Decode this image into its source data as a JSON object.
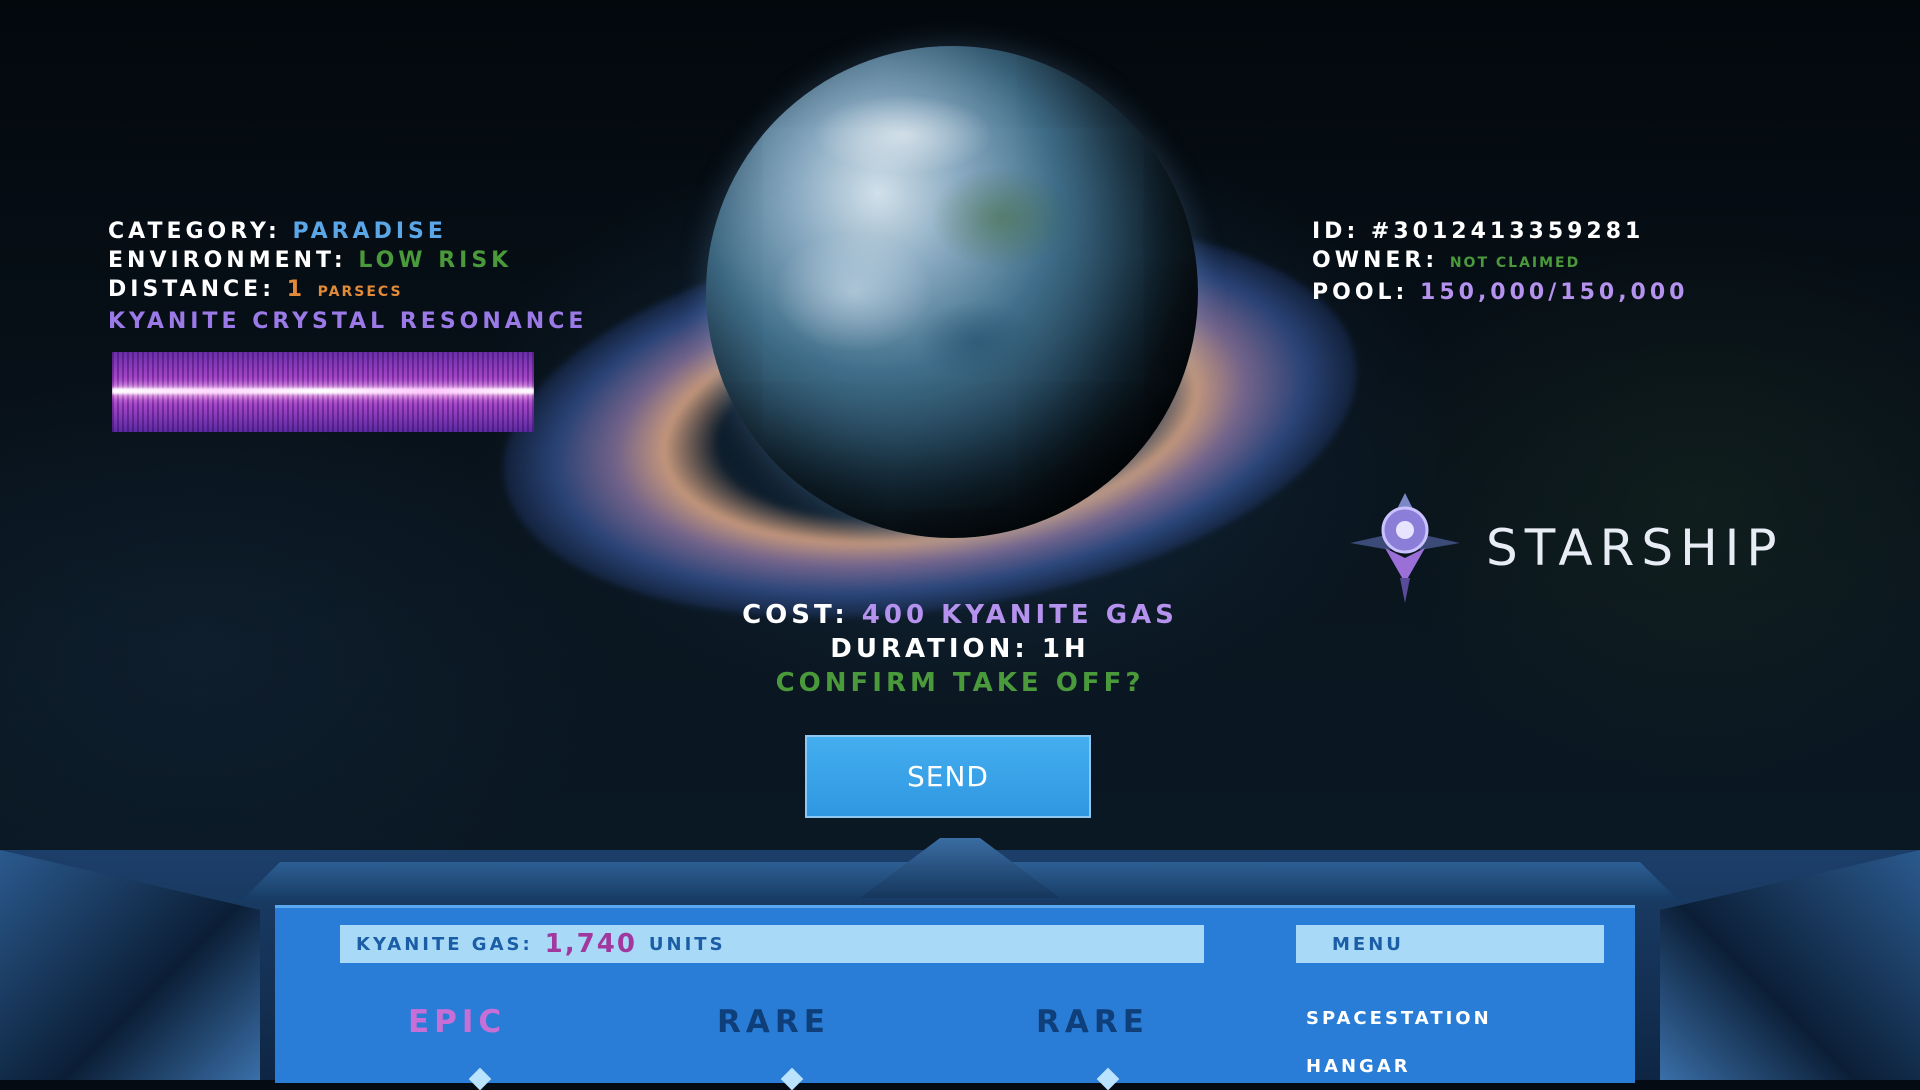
{
  "planet_info": {
    "category_label": "CATEGORY:",
    "category_value": "PARADISE",
    "environment_label": "ENVIRONMENT:",
    "environment_value": "LOW RISK",
    "distance_label": "DISTANCE:",
    "distance_value": "1",
    "distance_unit": "PARSECS",
    "resonance_label": "KYANITE CRYSTAL RESONANCE"
  },
  "ownership": {
    "id_label": "ID:",
    "id_value": "#3012413359281",
    "owner_label": "OWNER:",
    "owner_value": "NOT CLAIMED",
    "pool_label": "POOL:",
    "pool_value": "150,000/150,000"
  },
  "ship": {
    "name": "STARSHIP",
    "icon": "starship-emblem-icon"
  },
  "launch": {
    "cost_label": "COST:",
    "cost_value": "400 KYANITE GAS",
    "duration_label": "DURATION:",
    "duration_value": "1H",
    "confirm_text": "CONFIRM TAKE OFF?",
    "send_label": "SEND"
  },
  "console": {
    "gas_label": "KYANITE GAS:",
    "gas_amount": "1,740",
    "gas_unit": "UNITS",
    "menu_label": "MENU",
    "rarities": [
      {
        "label": "EPIC",
        "color": "#c76fd6"
      },
      {
        "label": "RARE",
        "color": "#0f3f7a"
      },
      {
        "label": "RARE",
        "color": "#0f3f7a"
      }
    ],
    "menu_items": [
      "SPACESTATION",
      "HANGAR"
    ]
  },
  "colors": {
    "accent_blue": "#5aa6e6",
    "low_risk_green": "#4a9a3c",
    "distance_orange": "#e28a38",
    "resonance_purple": "#9b7ae8",
    "button_blue": "#3aa3ea",
    "panel_blue": "#2a7dd6"
  }
}
